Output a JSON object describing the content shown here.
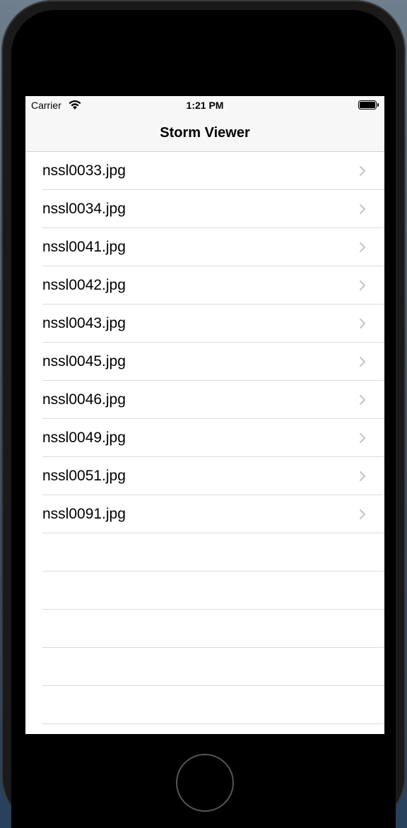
{
  "status_bar": {
    "carrier": "Carrier",
    "time": "1:21 PM",
    "wifi_icon": "wifi-icon",
    "battery_icon": "battery-icon"
  },
  "nav": {
    "title": "Storm Viewer"
  },
  "items": [
    {
      "label": "nssl0033.jpg"
    },
    {
      "label": "nssl0034.jpg"
    },
    {
      "label": "nssl0041.jpg"
    },
    {
      "label": "nssl0042.jpg"
    },
    {
      "label": "nssl0043.jpg"
    },
    {
      "label": "nssl0045.jpg"
    },
    {
      "label": "nssl0046.jpg"
    },
    {
      "label": "nssl0049.jpg"
    },
    {
      "label": "nssl0051.jpg"
    },
    {
      "label": "nssl0091.jpg"
    }
  ],
  "colors": {
    "bar_background": "#f7f7f7",
    "separator": "#dcdce0",
    "chevron": "#c4c4c8"
  }
}
